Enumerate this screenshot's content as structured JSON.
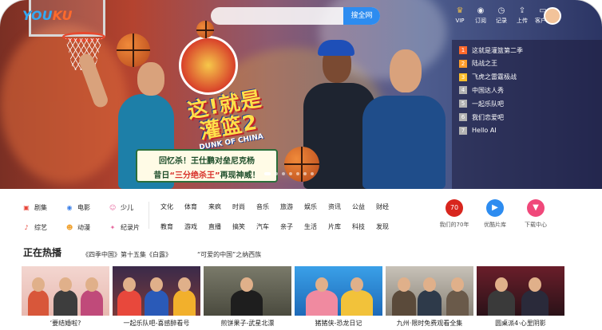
{
  "header": {
    "logo_main": "YOU",
    "logo_accent": "KU",
    "search_button": "搜全网",
    "search_placeholder": "",
    "icons": [
      {
        "name": "vip-icon",
        "glyph": "♛",
        "label": "VIP"
      },
      {
        "name": "subscribe-icon",
        "glyph": "◉",
        "label": "订阅"
      },
      {
        "name": "history-icon",
        "glyph": "◷",
        "label": "记录"
      },
      {
        "name": "upload-icon",
        "glyph": "⇪",
        "label": "上传"
      },
      {
        "name": "client-icon",
        "glyph": "▭",
        "label": "客户端"
      }
    ]
  },
  "hero": {
    "show_logo_big": "这!就是灌篮2",
    "show_logo_small": "DUNK OF CHINA",
    "promo_line1": "回忆杀！王仕鹏对垒尼克杨",
    "promo_line2_pre": "昔日",
    "promo_line2_mid": "“三分绝杀王”",
    "promo_line2_post": "再现神威！"
  },
  "hot_list": [
    {
      "rank": "1",
      "title": "这就是灌篮第二季"
    },
    {
      "rank": "2",
      "title": "陆战之王"
    },
    {
      "rank": "3",
      "title": "飞虎之雷霆极战"
    },
    {
      "rank": "4",
      "title": "中国达人秀"
    },
    {
      "rank": "5",
      "title": "一起乐队吧"
    },
    {
      "rank": "6",
      "title": "我们恋爱吧"
    },
    {
      "rank": "7",
      "title": "Hello AI"
    }
  ],
  "nav": {
    "left_row1": [
      {
        "icon": "drama-icon",
        "glyph": "▣",
        "color": "#e8483c",
        "label": "剧集"
      },
      {
        "icon": "movie-icon",
        "glyph": "◉",
        "color": "#3a7fe8",
        "label": "电影"
      },
      {
        "icon": "kids-icon",
        "glyph": "☺",
        "color": "#e86aa0",
        "label": "少儿"
      }
    ],
    "left_row2": [
      {
        "icon": "variety-icon",
        "glyph": "♪",
        "color": "#e8483c",
        "label": "综艺"
      },
      {
        "icon": "anime-icon",
        "glyph": "☻",
        "color": "#f0a02c",
        "label": "动漫"
      },
      {
        "icon": "documentary-icon",
        "glyph": "✦",
        "color": "#e86aa0",
        "label": "纪录片"
      }
    ],
    "grid_row1": [
      "文化",
      "体育",
      "来疯",
      "时尚",
      "音乐",
      "旅游",
      "娱乐",
      "资讯",
      "公益",
      "财经"
    ],
    "grid_row2": [
      "教育",
      "游戏",
      "直播",
      "搞笑",
      "汽车",
      "亲子",
      "生活",
      "片库",
      "科技",
      "发现"
    ],
    "quick": [
      {
        "icon": "anniversary-70-icon",
        "glyph": "70",
        "color": "#d8261e",
        "label": "我们的70年"
      },
      {
        "icon": "film-library-icon",
        "glyph": "▶",
        "color": "#2d8cf0",
        "label": "优酷片库"
      },
      {
        "icon": "download-icon",
        "glyph": "▼",
        "color": "#f0487a",
        "label": "下载中心"
      }
    ]
  },
  "section": {
    "title": "正在热播",
    "tab1": "《四季中国》第十五集《白露》",
    "tab2": "“可爱的中国”之纳西族"
  },
  "cards": [
    {
      "caption": "‘要结婚啦?"
    },
    {
      "caption": "一起乐队吧-喜感醉看号"
    },
    {
      "caption": "煎饼果子-武星北漂"
    },
    {
      "caption": "猪猪侠-恐龙日记"
    },
    {
      "caption": "九州·限时免费观看全集"
    },
    {
      "caption": "圆桌派4·心里阴影"
    }
  ],
  "colors": {
    "accent": "#2d8cf0",
    "rank1": "#ff6a2c",
    "rank2": "#ff9d2c",
    "rank3": "#ffbe2c"
  }
}
